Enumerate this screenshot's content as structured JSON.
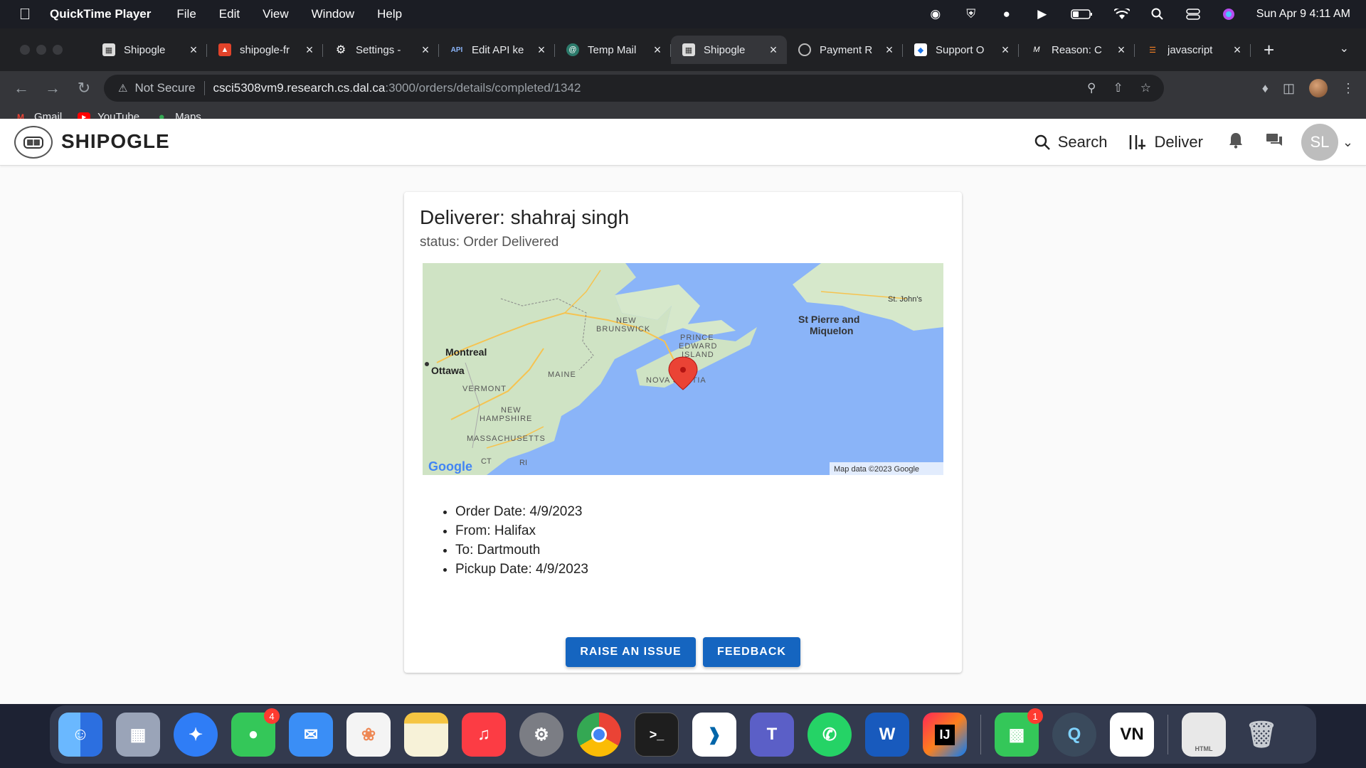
{
  "menubar": {
    "app": "QuickTime Player",
    "items": [
      "File",
      "Edit",
      "View",
      "Window",
      "Help"
    ],
    "datetime": "Sun Apr 9  4:11 AM"
  },
  "tabs": [
    {
      "title": "Shipogle",
      "active": false
    },
    {
      "title": "shipogle-fr",
      "active": false
    },
    {
      "title": "Settings -",
      "active": false
    },
    {
      "title": "Edit API ke",
      "active": false
    },
    {
      "title": "Temp Mail",
      "active": false
    },
    {
      "title": "Shipogle",
      "active": true
    },
    {
      "title": "Payment R",
      "active": false
    },
    {
      "title": "Support O",
      "active": false
    },
    {
      "title": "Reason: C",
      "active": false
    },
    {
      "title": "javascript",
      "active": false
    }
  ],
  "address": {
    "security": "Not Secure",
    "host": "csci5308vm9.research.cs.dal.ca",
    "path": ":3000/orders/details/completed/1342"
  },
  "bookmarks": [
    "Gmail",
    "YouTube",
    "Maps"
  ],
  "site": {
    "brand": "SHIPOGLE",
    "nav": {
      "search": "Search",
      "deliver": "Deliver"
    },
    "avatar_initials": "SL"
  },
  "order": {
    "deliverer_heading": "Deliverer: shahraj singh",
    "status": "status: Order Delivered",
    "details": [
      "Order Date: 4/9/2023",
      "From: Halifax",
      "To: Dartmouth",
      "Pickup Date: 4/9/2023"
    ],
    "raise_issue": "RAISE AN ISSUE",
    "feedback": "FEEDBACK"
  },
  "map": {
    "labels": {
      "montreal": "Montreal",
      "ottawa": "Ottawa",
      "new_brunswick_1": "NEW",
      "new_brunswick_2": "BRUNSWICK",
      "pei_1": "PRINCE",
      "pei_2": "EDWARD",
      "pei_3": "ISLAND",
      "nova_scotia": "NOVA SCOTIA",
      "maine": "MAINE",
      "vermont": "VERMONT",
      "nh_1": "NEW",
      "nh_2": "HAMPSHIRE",
      "massachusetts": "MASSACHUSETTS",
      "ct": "CT",
      "ri": "RI",
      "st_pierre_1": "St Pierre and",
      "st_pierre_2": "Miquelon",
      "st_johns": "St. John's",
      "google": "Google",
      "attribution": "Map data ©2023 Google"
    }
  },
  "dock": {
    "apps": [
      {
        "name": "finder",
        "label": "",
        "color": "#3d8bfd"
      },
      {
        "name": "launchpad",
        "label": "",
        "color": "#9aa4b8"
      },
      {
        "name": "safari",
        "label": "",
        "color": "#2f7df6"
      },
      {
        "name": "messages",
        "label": "",
        "color": "#34c759",
        "badge": "4"
      },
      {
        "name": "mail",
        "label": "",
        "color": "#3a8ef6"
      },
      {
        "name": "photos",
        "label": "",
        "color": "#f4f4f4"
      },
      {
        "name": "notes",
        "label": "",
        "color": "#f7f2d8"
      },
      {
        "name": "music",
        "label": "",
        "color": "#fc3c44"
      },
      {
        "name": "system-settings",
        "label": "",
        "color": "#7b7d84"
      },
      {
        "name": "chrome",
        "label": "",
        "color": "#ffffff"
      },
      {
        "name": "terminal",
        "label": ">_",
        "color": "#1e1e1e"
      },
      {
        "name": "vscode",
        "label": "",
        "color": "#ffffff"
      },
      {
        "name": "teams",
        "label": "T",
        "color": "#5b5fc7"
      },
      {
        "name": "whatsapp",
        "label": "",
        "color": "#25d366"
      },
      {
        "name": "word",
        "label": "W",
        "color": "#185abd"
      },
      {
        "name": "intellij",
        "label": "IJ",
        "color": "#000000"
      },
      {
        "name": "facetime",
        "label": "",
        "color": "#34c759",
        "badge": "1"
      },
      {
        "name": "quicktime",
        "label": "",
        "color": "#3a4a5c"
      },
      {
        "name": "vn",
        "label": "VN",
        "color": "#111111"
      },
      {
        "name": "html-file",
        "label": "HTML",
        "color": "#e8e8e8"
      },
      {
        "name": "trash",
        "label": "",
        "color": "#9aa0a6"
      }
    ]
  },
  "colors": {
    "primary_button": "#1565c0",
    "map_water": "#8ab4f8",
    "map_land": "#cfe3c4"
  }
}
